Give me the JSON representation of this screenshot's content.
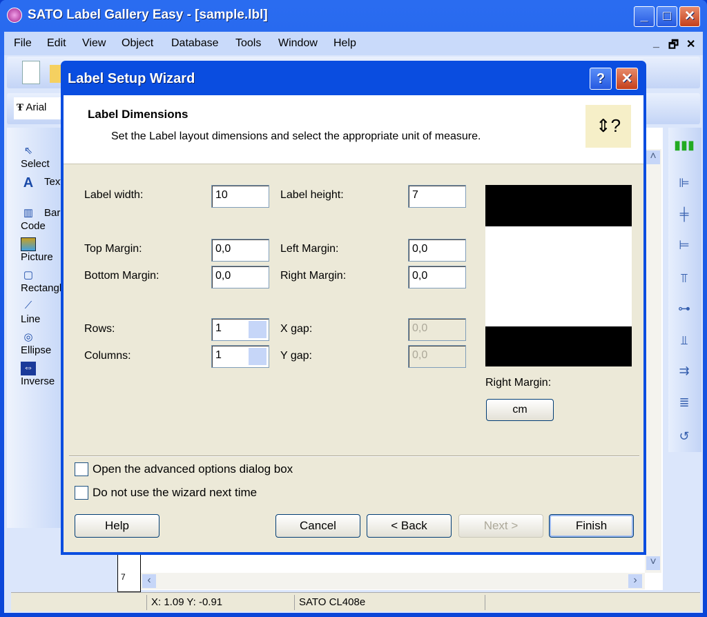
{
  "app": {
    "title": "SATO Label Gallery Easy - [sample.lbl]",
    "window_buttons": [
      "minimize",
      "maximize",
      "close"
    ]
  },
  "menu": {
    "items": [
      "File",
      "Edit",
      "View",
      "Object",
      "Database",
      "Tools",
      "Window",
      "Help"
    ],
    "mdi_controls": [
      "_",
      "🗗",
      "✕"
    ]
  },
  "font_toolbar": {
    "font": "Arial"
  },
  "tools": [
    {
      "label": "Select",
      "icon": "cursor-icon"
    },
    {
      "label": "Text",
      "icon": "text-icon"
    },
    {
      "label": "Bar Code",
      "icon": "barcode-icon"
    },
    {
      "label": "Picture",
      "icon": "picture-icon"
    },
    {
      "label": "Rectangle",
      "icon": "rectangle-icon"
    },
    {
      "label": "Line",
      "icon": "line-icon"
    },
    {
      "label": "Ellipse",
      "icon": "ellipse-icon"
    },
    {
      "label": "Inverse",
      "icon": "inverse-icon"
    }
  ],
  "ruler": {
    "mark": "7"
  },
  "status": {
    "coords": "X:  1.09 Y:  -0.91",
    "printer": "SATO CL408e"
  },
  "dialog": {
    "title": "Label Setup Wizard",
    "heading": "Label Dimensions",
    "description": "Set the Label layout dimensions and select the appropriate unit of measure.",
    "fields": {
      "label_width": {
        "label": "Label width:",
        "value": "10"
      },
      "label_height": {
        "label": "Label height:",
        "value": "7"
      },
      "top_margin": {
        "label": "Top Margin:",
        "value": "0,0"
      },
      "left_margin": {
        "label": "Left Margin:",
        "value": "0,0"
      },
      "bottom_margin": {
        "label": "Bottom Margin:",
        "value": "0,0"
      },
      "right_margin": {
        "label": "Right Margin:",
        "value": "0,0"
      },
      "rows": {
        "label": "Rows:",
        "value": "1"
      },
      "x_gap": {
        "label": "X gap:",
        "value": "0,0"
      },
      "columns": {
        "label": "Columns:",
        "value": "1"
      },
      "y_gap": {
        "label": "Y gap:",
        "value": "0,0"
      }
    },
    "preview_caption": "Right Margin:",
    "unit": "cm",
    "checkboxes": [
      {
        "label": "Open the advanced options dialog box",
        "checked": false
      },
      {
        "label": "Do not use the wizard next time",
        "checked": false
      }
    ],
    "buttons": {
      "help": "Help",
      "cancel": "Cancel",
      "back": "< Back",
      "next": "Next >",
      "finish": "Finish"
    }
  }
}
